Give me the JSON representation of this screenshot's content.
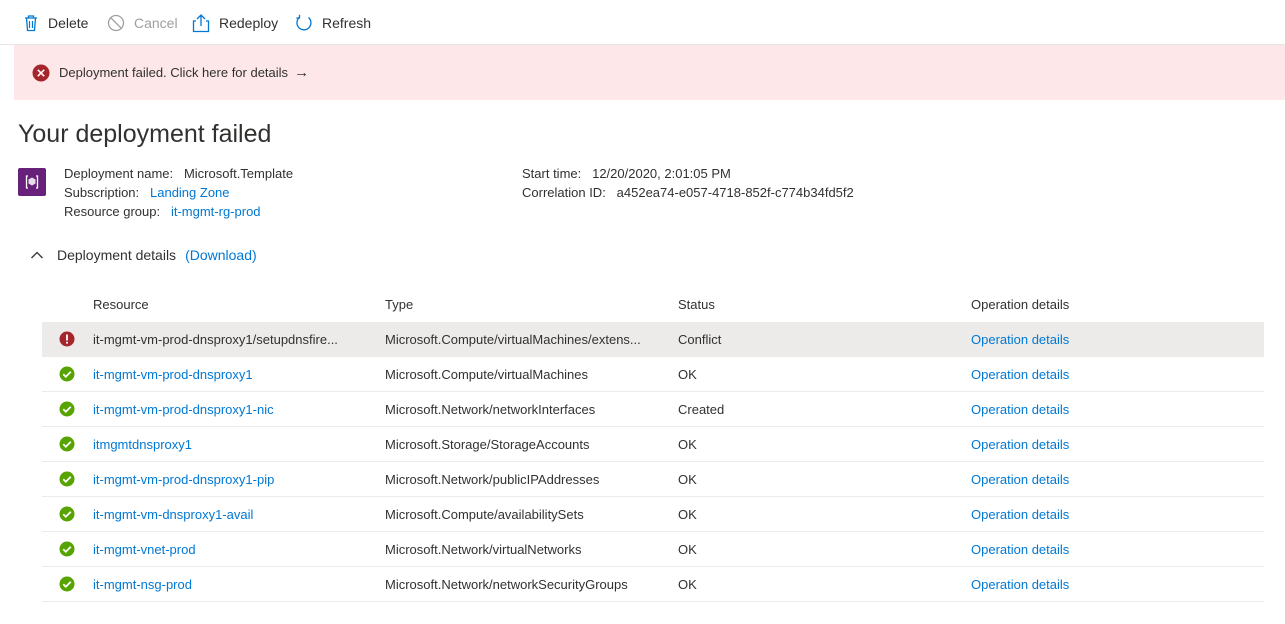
{
  "toolbar": {
    "delete_label": "Delete",
    "cancel_label": "Cancel",
    "redeploy_label": "Redeploy",
    "refresh_label": "Refresh"
  },
  "banner": {
    "text": "Deployment failed. Click here for details",
    "arrow": "→",
    "color": "#fde7e9",
    "icon": "error-circle-icon"
  },
  "title": "Your deployment failed",
  "deployment": {
    "name_label": "Deployment name:",
    "name": "Microsoft.Template",
    "subscription_label": "Subscription:",
    "subscription": "Landing Zone",
    "resource_group_label": "Resource group:",
    "resource_group": "it-mgmt-rg-prod",
    "start_time_label": "Start time:",
    "start_time": "12/20/2020, 2:01:05 PM",
    "correlation_label": "Correlation ID:",
    "correlation_id": "a452ea74-e057-4718-852f-c774b34fd5f2"
  },
  "details": {
    "label": "Deployment details",
    "download_label": "(Download)"
  },
  "table": {
    "headers": [
      "Resource",
      "Type",
      "Status",
      "Operation details"
    ],
    "rows": [
      {
        "status_icon": "error-icon",
        "resource": "it-mgmt-vm-prod-dnsproxy1/setupdnsfire...",
        "type": "Microsoft.Compute/virtualMachines/extens...",
        "status": "Conflict",
        "op": "Operation details"
      },
      {
        "status_icon": "success-icon",
        "resource": "it-mgmt-vm-prod-dnsproxy1",
        "type": "Microsoft.Compute/virtualMachines",
        "status": "OK",
        "op": "Operation details"
      },
      {
        "status_icon": "success-icon",
        "resource": "it-mgmt-vm-prod-dnsproxy1-nic",
        "type": "Microsoft.Network/networkInterfaces",
        "status": "Created",
        "op": "Operation details"
      },
      {
        "status_icon": "success-icon",
        "resource": "itmgmtdnsproxy1",
        "type": "Microsoft.Storage/StorageAccounts",
        "status": "OK",
        "op": "Operation details"
      },
      {
        "status_icon": "success-icon",
        "resource": "it-mgmt-vm-prod-dnsproxy1-pip",
        "type": "Microsoft.Network/publicIPAddresses",
        "status": "OK",
        "op": "Operation details"
      },
      {
        "status_icon": "success-icon",
        "resource": "it-mgmt-vm-dnsproxy1-avail",
        "type": "Microsoft.Compute/availabilitySets",
        "status": "OK",
        "op": "Operation details"
      },
      {
        "status_icon": "success-icon",
        "resource": "it-mgmt-vnet-prod",
        "type": "Microsoft.Network/virtualNetworks",
        "status": "OK",
        "op": "Operation details"
      },
      {
        "status_icon": "success-icon",
        "resource": "it-mgmt-nsg-prod",
        "type": "Microsoft.Network/networkSecurityGroups",
        "status": "OK",
        "op": "Operation details"
      }
    ]
  },
  "colors": {
    "link": "#0078d4",
    "success": "#57a300",
    "error": "#a4262c",
    "banner_bg": "#fde7e9",
    "icon_bg": "#68217a"
  }
}
